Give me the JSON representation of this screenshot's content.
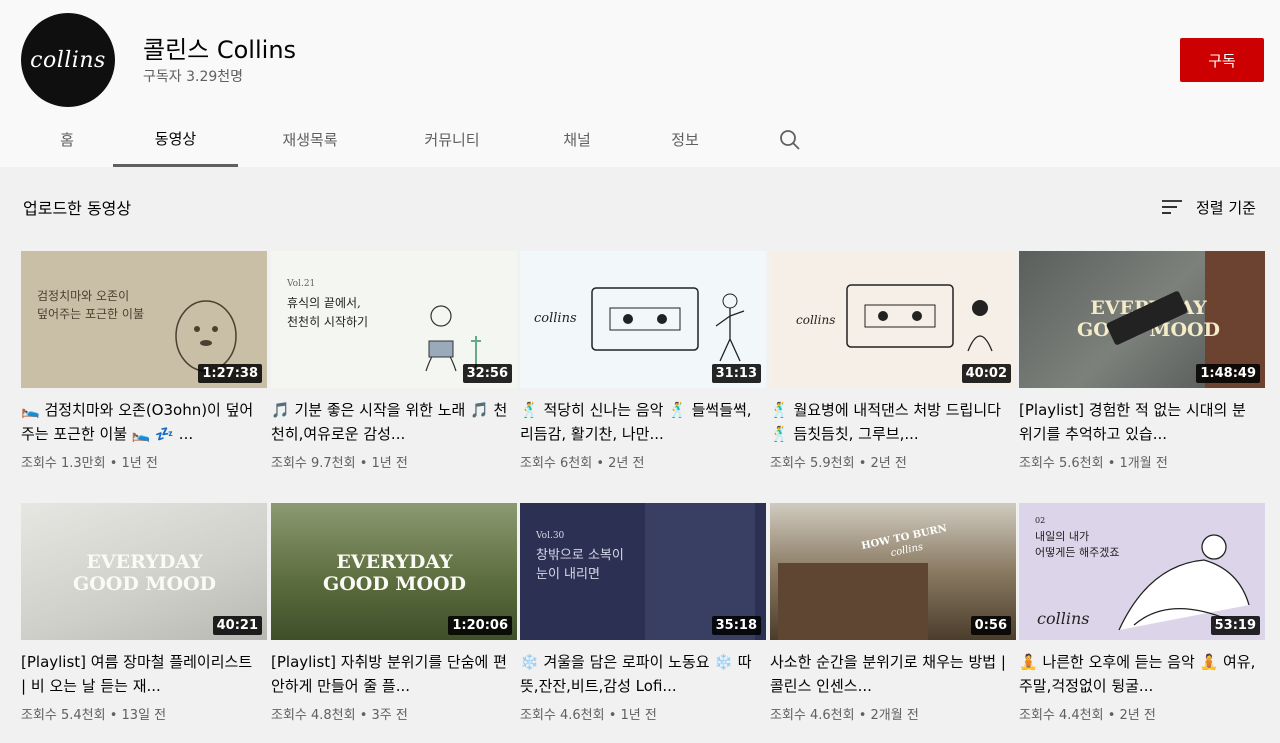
{
  "channel": {
    "logo_text": "collins",
    "name": "콜린스 Collins",
    "subscribers": "구독자 3.29천명",
    "subscribe_label": "구독"
  },
  "tabs": [
    {
      "label": "홈"
    },
    {
      "label": "동영상"
    },
    {
      "label": "재생목록"
    },
    {
      "label": "커뮤니티"
    },
    {
      "label": "채널"
    },
    {
      "label": "정보"
    }
  ],
  "section": {
    "title": "업로드한 동영상",
    "sort_label": "정렬 기준"
  },
  "videos": [
    {
      "title": "🛌 검정치마와 오존(O3ohn)이 덮어주는 포근한 이불 🛌 💤 ...",
      "meta": "조회수 1.3만회 • 1년 전",
      "duration": "1:27:38",
      "thumb_lines": [
        "검정치마와 오존이",
        "덮어주는 포근한 이불"
      ]
    },
    {
      "title": "🎵 기분 좋은 시작을 위한 노래 🎵 천천히,여유로운 감성...",
      "meta": "조회수 9.7천회 • 1년 전",
      "duration": "32:56",
      "thumb_lines": [
        "Vol.21",
        "휴식의 끝에서,",
        "천천히 시작하기"
      ]
    },
    {
      "title": "🕺 적당히 신나는 음악 🕺 들썩들썩, 리듬감, 활기찬, 나만...",
      "meta": "조회수 6천회 • 2년 전",
      "duration": "31:13",
      "thumb_lines": [
        "collins"
      ]
    },
    {
      "title": "🕺 월요병에 내적댄스 처방 드립니다 🕺 듬칫듬칫, 그루브,...",
      "meta": "조회수 5.9천회 • 2년 전",
      "duration": "40:02",
      "thumb_lines": [
        "collins"
      ]
    },
    {
      "title": "[Playlist] 경험한 적 없는 시대의 분위기를 추억하고 있습...",
      "meta": "조회수 5.6천회 • 1개월 전",
      "duration": "1:48:49",
      "thumb_lines": [
        "EVERYDAY",
        "GOOD MOOD"
      ]
    },
    {
      "title": "[Playlist] 여름 장마철 플레이리스트 | 비 오는 날 듣는 재...",
      "meta": "조회수 5.4천회 • 13일 전",
      "duration": "40:21",
      "thumb_lines": [
        "EVERYDAY",
        "GOOD MOOD"
      ]
    },
    {
      "title": "[Playlist] 자취방 분위기를 단숨에 편안하게 만들어 줄 플...",
      "meta": "조회수 4.8천회 • 3주 전",
      "duration": "1:20:06",
      "thumb_lines": [
        "EVERYDAY",
        "GOOD MOOD"
      ]
    },
    {
      "title": "❄️ 겨울을 담은 로파이 노동요 ❄️ 따뜻,잔잔,비트,감성 Lofi...",
      "meta": "조회수 4.6천회 • 1년 전",
      "duration": "35:18",
      "thumb_lines": [
        "Vol.30",
        "창밖으로 소복이",
        "눈이 내리면"
      ]
    },
    {
      "title": "사소한 순간을 분위기로 채우는 방법 | 콜린스 인센스...",
      "meta": "조회수 4.6천회 • 2개월 전",
      "duration": "0:56",
      "thumb_lines": [
        "HOW TO BURN",
        "collins"
      ]
    },
    {
      "title": "🧘 나른한 오후에 듣는 음악 🧘 여유,주말,걱정없이 뒹굴...",
      "meta": "조회수 4.4천회 • 2년 전",
      "duration": "53:19",
      "thumb_lines": [
        "02",
        "내일의 내가",
        "어떻게든 해주겠죠",
        "collins"
      ]
    }
  ],
  "colors": {
    "subscribe_bg": "#cc0000",
    "content_bg": "#f1f1f1",
    "header_bg": "#f9f9f9"
  }
}
